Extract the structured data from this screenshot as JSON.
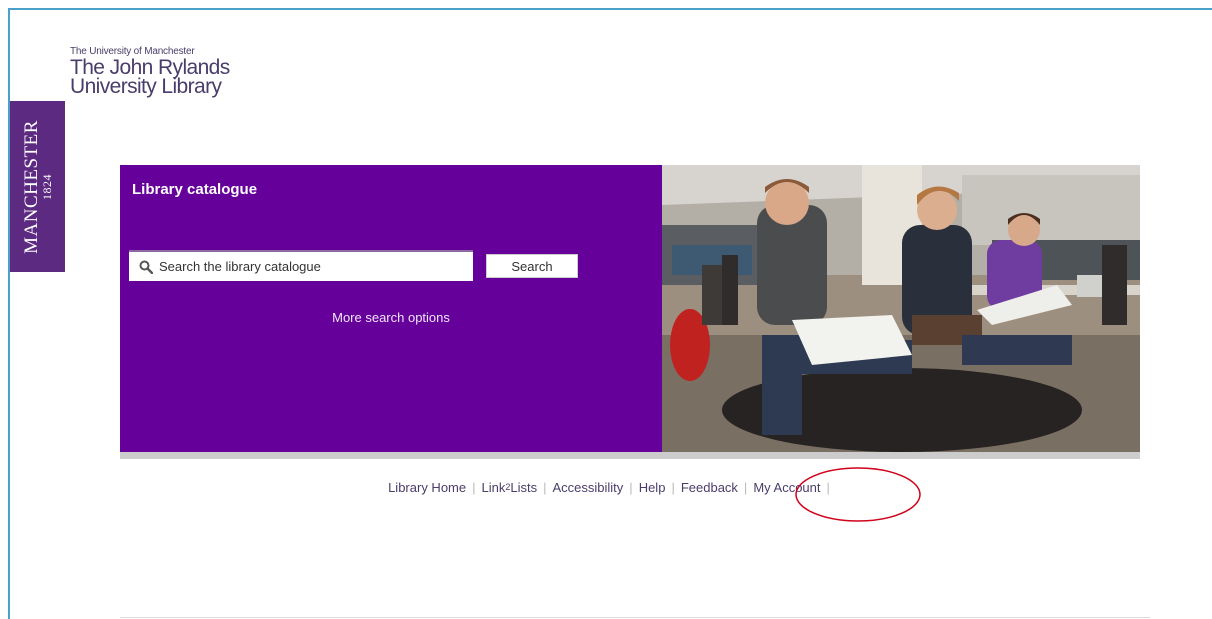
{
  "logo": {
    "university": "The University of Manchester",
    "line1": "The John Rylands",
    "line2": "University Library"
  },
  "badge": {
    "name": "MANCHESTER",
    "year": "1824"
  },
  "hero": {
    "title": "Library catalogue",
    "search_placeholder": "Search the library catalogue",
    "search_button": "Search",
    "more_options": "More search options"
  },
  "footer": {
    "library_home": "Library Home",
    "link_prefix": "Link",
    "link_sup": "2",
    "link_suffix": "Lists",
    "accessibility": "Accessibility",
    "help": "Help",
    "feedback": "Feedback",
    "my_account": "My Account"
  },
  "colors": {
    "purple": "#66009a",
    "badge_purple": "#5d2a82",
    "annotation_red": "#d0021b",
    "frame_blue": "#4aa0c8"
  },
  "icons": [
    "search-icon"
  ]
}
